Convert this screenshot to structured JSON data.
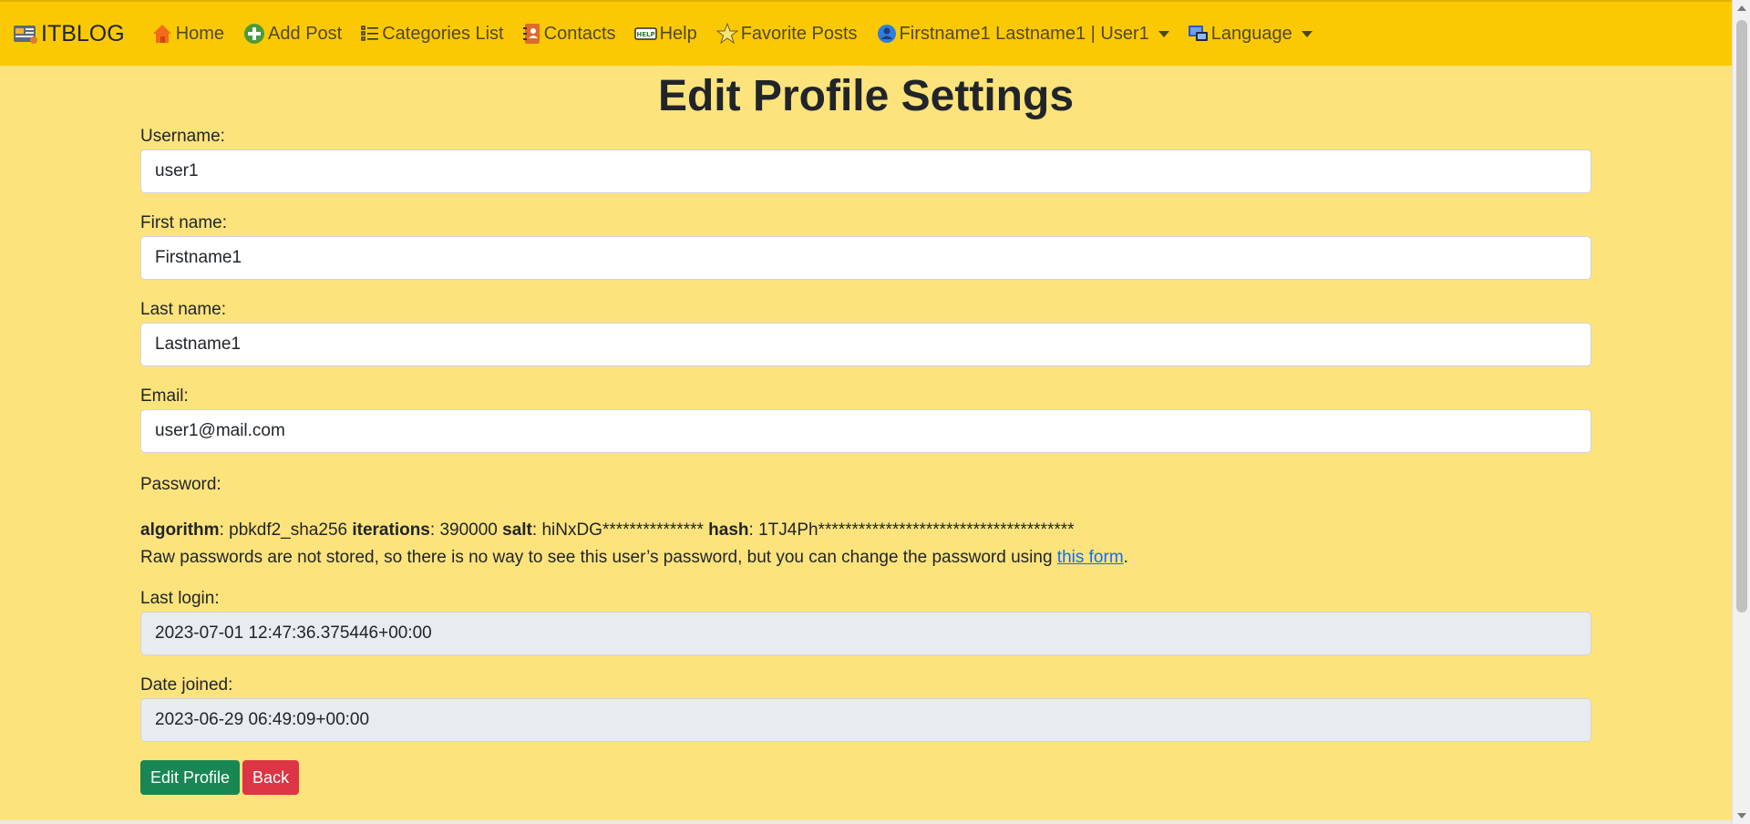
{
  "navbar": {
    "brand": "ITBLOG",
    "items": [
      {
        "label": "Home",
        "icon": "home-icon"
      },
      {
        "label": "Add Post",
        "icon": "plus-circle-icon"
      },
      {
        "label": "Categories List",
        "icon": "list-icon"
      },
      {
        "label": "Contacts",
        "icon": "address-book-icon"
      },
      {
        "label": "Help",
        "icon": "help-icon"
      },
      {
        "label": "Favorite Posts",
        "icon": "star-icon"
      },
      {
        "label": "Firstname1 Lastname1 | User1",
        "icon": "user-icon"
      },
      {
        "label": "Language",
        "icon": "language-icon"
      }
    ]
  },
  "page": {
    "title": "Edit Profile Settings"
  },
  "form": {
    "username": {
      "label": "Username:",
      "value": "user1"
    },
    "first_name": {
      "label": "First name:",
      "value": "Firstname1"
    },
    "last_name": {
      "label": "Last name:",
      "value": "Lastname1"
    },
    "email": {
      "label": "Email:",
      "value": "user1@mail.com"
    },
    "password": {
      "label": "Password:",
      "algorithm_label": "algorithm",
      "algorithm": "pbkdf2_sha256",
      "iterations_label": "iterations",
      "iterations": "390000",
      "salt_label": "salt",
      "salt": "hiNxDG***************",
      "hash_label": "hash",
      "hash": "1TJ4Ph**************************************",
      "help_text": "Raw passwords are not stored, so there is no way to see this user’s password, but you can change the password using ",
      "help_link": "this form",
      "help_end": "."
    },
    "last_login": {
      "label": "Last login:",
      "value": "2023-07-01 12:47:36.375446+00:00"
    },
    "date_joined": {
      "label": "Date joined:",
      "value": "2023-06-29 06:49:09+00:00"
    },
    "submit_label": "Edit Profile",
    "back_label": "Back"
  },
  "colors": {
    "navbar_bg": "#fbc904",
    "page_bg": "#fde37c",
    "primary_button": "#198754",
    "danger_button": "#dc3545",
    "link": "#0d6efd"
  }
}
